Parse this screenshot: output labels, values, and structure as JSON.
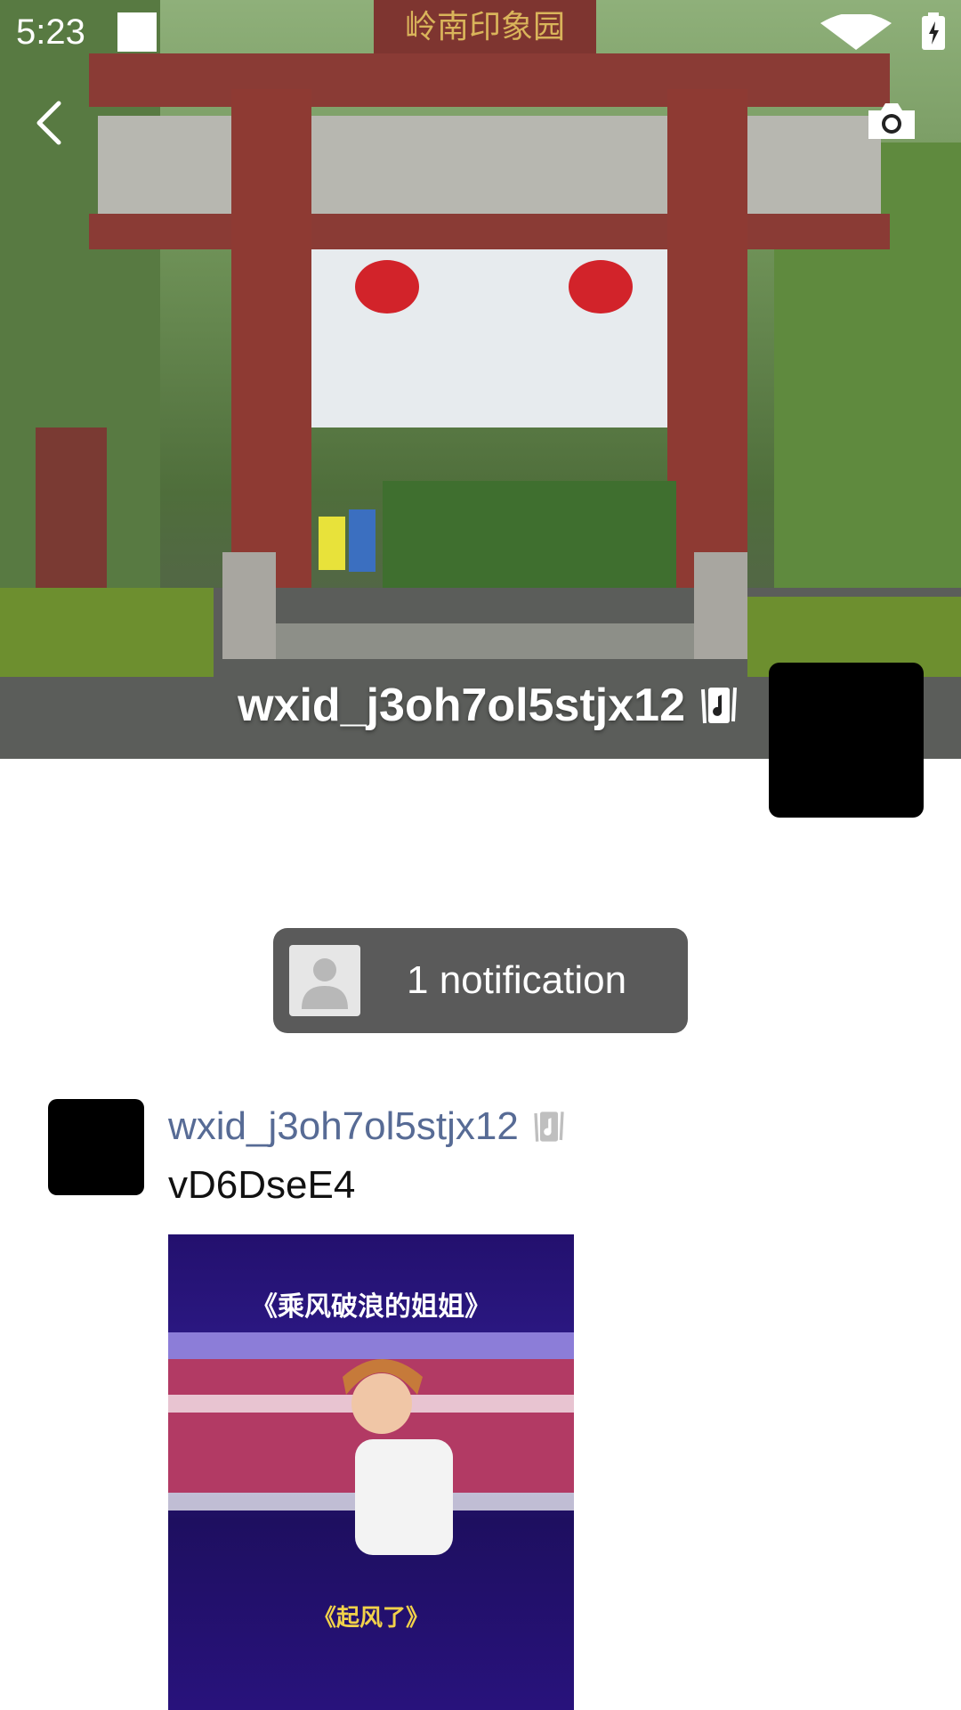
{
  "status_bar": {
    "time": "5:23",
    "icons": [
      "notification-square-icon",
      "wifi-icon",
      "battery-charging-icon"
    ]
  },
  "header": {
    "back_icon": "chevron-left-icon",
    "camera_icon": "camera-icon"
  },
  "cover": {
    "username": "wxid_j3oh7ol5stjx12",
    "badge_icon": "music-card-icon",
    "signboard_text": "岭南印象园"
  },
  "notification": {
    "text": "1 notification",
    "avatar_icon": "default-user-icon"
  },
  "post": {
    "username": "wxid_j3oh7ol5stjx12",
    "badge_icon": "music-card-icon",
    "text": "vD6DseE4",
    "image": {
      "title": "《乘风破浪的姐姐》",
      "subtitle": "《起风了》"
    }
  },
  "colors": {
    "link_name": "#576b95",
    "notification_bg": "#5a5a5a"
  }
}
